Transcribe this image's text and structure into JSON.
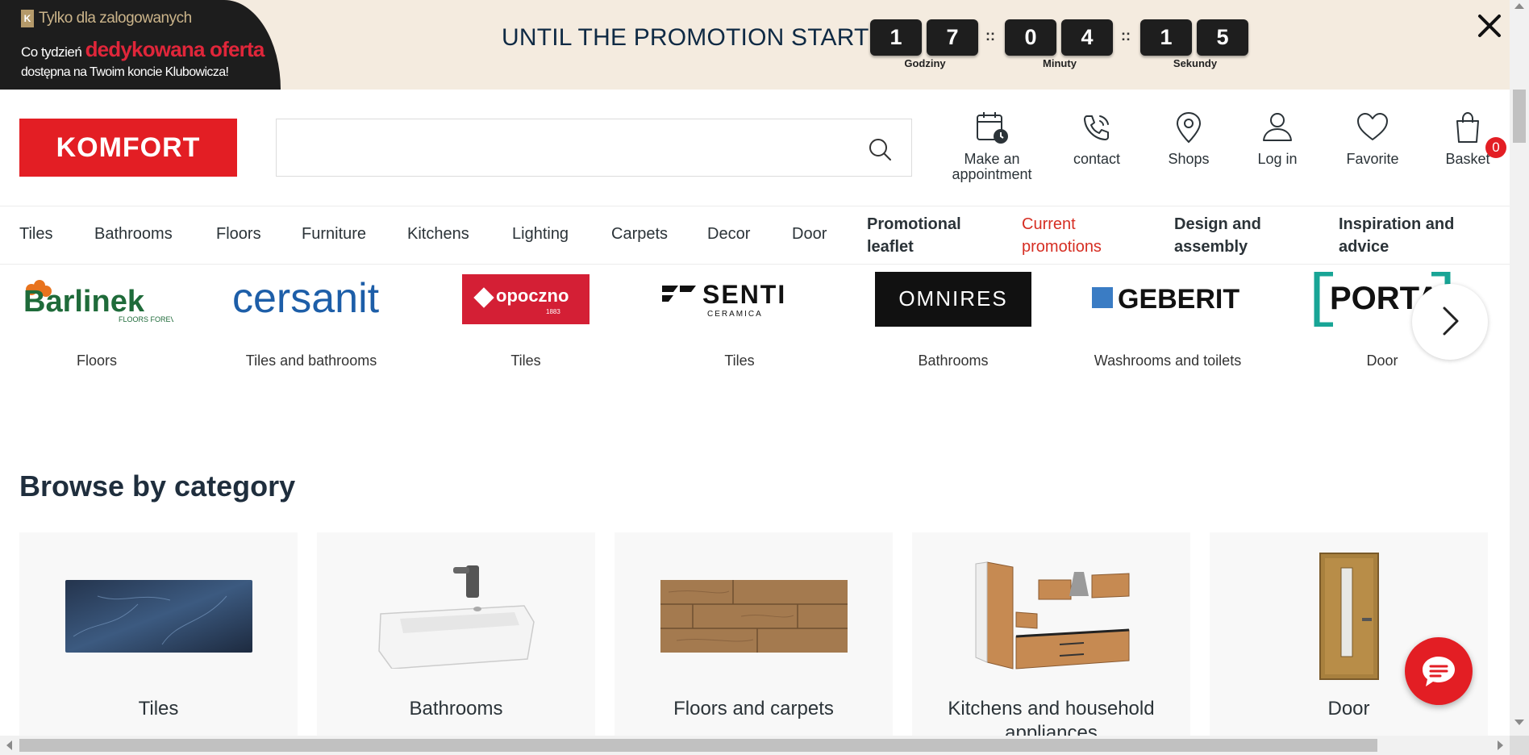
{
  "promo": {
    "badge_line1": "Tylko dla zalogowanych",
    "badge_line2_prefix": "Co tydzień",
    "badge_line2_highlight": "dedykowana oferta",
    "badge_line3": "dostępna na Twoim koncie Klubowicza!",
    "countdown_title": "UNTIL THE PROMOTION STARTS:",
    "hours": [
      "1",
      "7"
    ],
    "minutes": [
      "0",
      "4"
    ],
    "seconds": [
      "1",
      "5"
    ],
    "hours_label": "Godziny",
    "minutes_label": "Minuty",
    "seconds_label": "Sekundy",
    "separator": "::",
    "close_label": "✕"
  },
  "header": {
    "logo": "KOMFORT",
    "search_placeholder": "",
    "actions": {
      "appointment": "Make an appointment",
      "contact": "contact",
      "shops": "Shops",
      "login": "Log in",
      "favorite": "Favorite",
      "basket": "Basket",
      "basket_count": "0"
    }
  },
  "nav": {
    "tiles": "Tiles",
    "bathrooms": "Bathrooms",
    "floors": "Floors",
    "furniture": "Furniture",
    "kitchens": "Kitchens",
    "lighting": "Lighting",
    "carpets": "Carpets",
    "decor": "Decor",
    "door": "Door",
    "promotional_leaflet_1": "Promotional",
    "promotional_leaflet_2": "leaflet",
    "current_promotions_1": "Current",
    "current_promotions_2": "promotions",
    "design_assembly_1": "Design and",
    "design_assembly_2": "assembly",
    "inspiration_advice_1": "Inspiration and",
    "inspiration_advice_2": "advice"
  },
  "brands": [
    {
      "name": "Barlinek",
      "sub": "FLOORS FOREVER",
      "caption": "Floors"
    },
    {
      "name": "cersanit",
      "caption": "Tiles and bathrooms"
    },
    {
      "name": "opoczno",
      "sub": "1883",
      "caption": "Tiles"
    },
    {
      "name": "SENTI",
      "sub": "CERAMICA",
      "caption": "Tiles"
    },
    {
      "name": "OMNIRES",
      "caption": "Bathrooms"
    },
    {
      "name": "GEBERIT",
      "caption": "Washrooms and toilets"
    },
    {
      "name": "PORTA",
      "caption": "Door"
    }
  ],
  "browse": {
    "title": "Browse by category",
    "categories": [
      "Tiles",
      "Bathrooms",
      "Floors and carpets",
      "Kitchens and household appliances",
      "Door"
    ]
  },
  "colors": {
    "brand_red": "#e31e24",
    "promo_bg": "#f4ebdf",
    "promo_red_text": "#d62e23",
    "heading": "#1f2e3d"
  }
}
